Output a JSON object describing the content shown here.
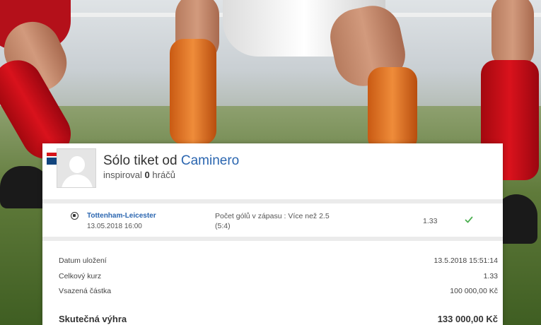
{
  "ticket": {
    "title_prefix": "Sólo tiket od",
    "username": "Caminero",
    "inspired_prefix": "inspiroval",
    "inspired_count": "0",
    "inspired_suffix": "hráčů"
  },
  "bet": {
    "match": "Tottenham-Leicester",
    "date": "13.05.2018 16:00",
    "market": "Počet gólů v zápasu : Více než 2.5",
    "score": "(5:4)",
    "odd": "1.33",
    "status_icon": "check-icon",
    "status_color": "#4caf50"
  },
  "summary": {
    "saved_label": "Datum uložení",
    "saved_value": "13.5.2018 15:51:14",
    "total_odd_label": "Celkový kurz",
    "total_odd_value": "1.33",
    "stake_label": "Vsazená částka",
    "stake_value": "100 000,00 Kč",
    "win_label": "Skutečná výhra",
    "win_value": "133 000,00 Kč"
  },
  "colors": {
    "link_blue": "#2b66b0",
    "separator": "#ebebeb"
  }
}
